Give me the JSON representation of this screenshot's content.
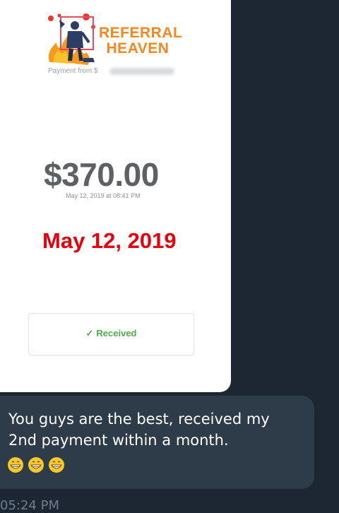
{
  "card": {
    "logo_text": "REFERRAL HEAVEN",
    "payment_from_label": "Payment from $",
    "amount": "$370.00",
    "amount_datetime": "May 12, 2019 at 08:41 PM",
    "overlay_date": "May 12, 2019",
    "status": {
      "icon": "check-icon",
      "label": "Received",
      "color": "#4cae4f"
    }
  },
  "message": {
    "line1": "You guys are the best, received my",
    "line2": "2nd payment within a month.",
    "emojis": [
      "grinning-face-icon",
      "grinning-face-icon",
      "grinning-face-icon"
    ],
    "time": "05:24 PM"
  },
  "colors": {
    "background": "#1d2733",
    "bubble": "#2e3b49",
    "logo_orange": "#f7861f",
    "overlay_red": "#e8000d"
  }
}
